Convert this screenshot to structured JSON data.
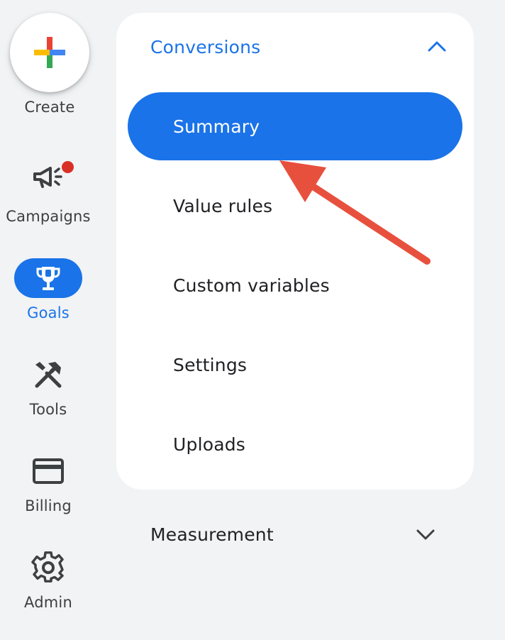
{
  "rail": {
    "create_label": "Create",
    "campaigns_label": "Campaigns",
    "goals_label": "Goals",
    "tools_label": "Tools",
    "billing_label": "Billing",
    "admin_label": "Admin"
  },
  "panel": {
    "section_title": "Conversions",
    "section_expanded": true,
    "items": [
      {
        "label": "Summary",
        "active": true
      },
      {
        "label": "Value rules",
        "active": false
      },
      {
        "label": "Custom variables",
        "active": false
      },
      {
        "label": "Settings",
        "active": false
      },
      {
        "label": "Uploads",
        "active": false
      }
    ]
  },
  "measurement": {
    "title": "Measurement",
    "expanded": false
  },
  "colors": {
    "accent": "#1a73e8",
    "background": "#f1f3f4",
    "notification": "#d93025",
    "annotation_arrow": "#e8503e"
  },
  "icons": {
    "create": "google-plus-icon",
    "campaigns": "megaphone-icon",
    "goals": "trophy-icon",
    "tools": "tools-icon",
    "billing": "credit-card-icon",
    "admin": "gear-icon",
    "section_toggle": "chevron-up-icon",
    "measurement_toggle": "chevron-down-icon"
  }
}
